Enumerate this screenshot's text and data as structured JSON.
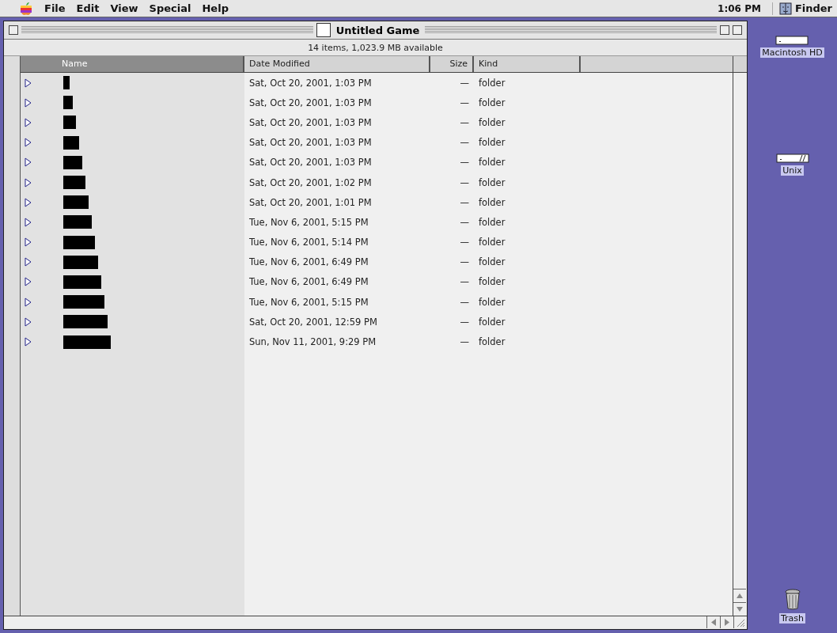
{
  "menu_bar": {
    "items": [
      "File",
      "Edit",
      "View",
      "Special",
      "Help"
    ],
    "clock": "1:06 PM",
    "app": "Finder"
  },
  "window": {
    "title": "Untitled Game",
    "info": "14 items, 1,023.9 MB available",
    "columns": [
      {
        "label": "Name",
        "selected": true
      },
      {
        "label": "Date Modified",
        "selected": false
      },
      {
        "label": "Size",
        "selected": false
      },
      {
        "label": "Kind",
        "selected": false
      }
    ],
    "rows": [
      {
        "expanded": false,
        "date": "Sat, Oct 20, 2001, 1:03 PM",
        "size": "—",
        "kind": "folder"
      },
      {
        "expanded": false,
        "date": "Sat, Oct 20, 2001, 1:03 PM",
        "size": "—",
        "kind": "folder"
      },
      {
        "expanded": false,
        "date": "Sat, Oct 20, 2001, 1:03 PM",
        "size": "—",
        "kind": "folder"
      },
      {
        "expanded": false,
        "date": "Sat, Oct 20, 2001, 1:03 PM",
        "size": "—",
        "kind": "folder"
      },
      {
        "expanded": false,
        "date": "Sat, Oct 20, 2001, 1:03 PM",
        "size": "—",
        "kind": "folder"
      },
      {
        "expanded": false,
        "date": "Sat, Oct 20, 2001, 1:02 PM",
        "size": "—",
        "kind": "folder"
      },
      {
        "expanded": false,
        "date": "Sat, Oct 20, 2001, 1:01 PM",
        "size": "—",
        "kind": "folder"
      },
      {
        "expanded": false,
        "date": "Tue, Nov 6, 2001, 5:15 PM",
        "size": "—",
        "kind": "folder"
      },
      {
        "expanded": false,
        "date": "Tue, Nov 6, 2001, 5:14 PM",
        "size": "—",
        "kind": "folder"
      },
      {
        "expanded": false,
        "date": "Tue, Nov 6, 2001, 6:49 PM",
        "size": "—",
        "kind": "folder"
      },
      {
        "expanded": false,
        "date": "Tue, Nov 6, 2001, 6:49 PM",
        "size": "—",
        "kind": "folder"
      },
      {
        "expanded": false,
        "date": "Tue, Nov 6, 2001, 5:15 PM",
        "size": "—",
        "kind": "folder"
      },
      {
        "expanded": false,
        "date": "Sat, Oct 20, 2001, 12:59 PM",
        "size": "—",
        "kind": "folder"
      },
      {
        "expanded": false,
        "date": "Sun, Nov 11, 2001, 9:29 PM",
        "size": "—",
        "kind": "folder"
      }
    ]
  },
  "desktop": {
    "icons": [
      {
        "kind": "disk",
        "label": "Macintosh HD"
      },
      {
        "kind": "unix",
        "label": "Unix"
      },
      {
        "kind": "trash",
        "label": "Trash"
      }
    ]
  }
}
